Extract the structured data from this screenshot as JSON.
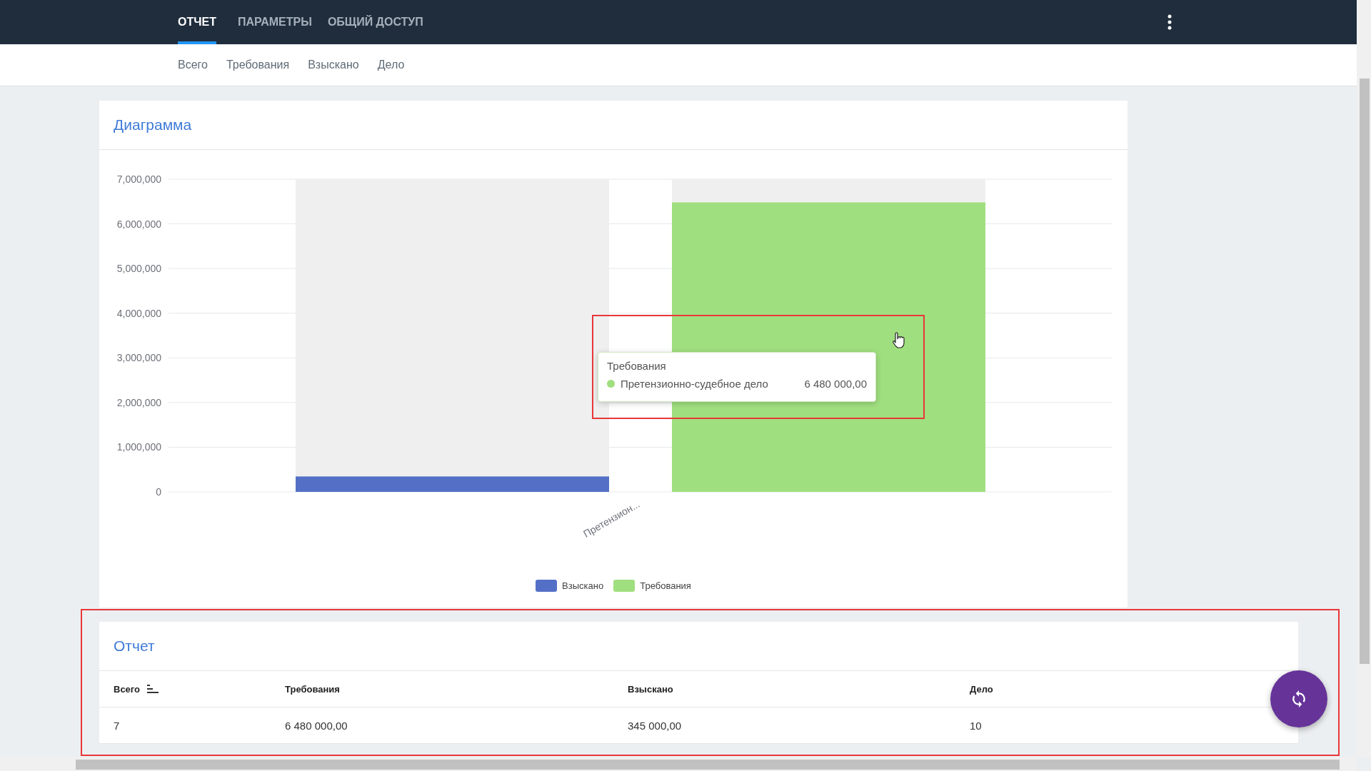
{
  "top_tabs": [
    {
      "label": "ОТЧЕТ",
      "selected": true
    },
    {
      "label": "ПАРАМЕТРЫ",
      "selected": false
    },
    {
      "label": "ОБЩИЙ ДОСТУП",
      "selected": false
    }
  ],
  "sub_nav": [
    "Всего",
    "Требования",
    "Взыскано",
    "Дело"
  ],
  "chart_card": {
    "title": "Диаграмма",
    "chart_data": {
      "type": "bar",
      "categories": [
        "Претензион..."
      ],
      "series": [
        {
          "name": "Взыскано",
          "color": "#5470c6",
          "values": [
            345000
          ]
        },
        {
          "name": "Требования",
          "color": "#a0df7f",
          "values": [
            6480000
          ]
        }
      ],
      "ylim": [
        0,
        7000000
      ],
      "grid": true,
      "yticks": [
        {
          "value": 0,
          "label": "0"
        },
        {
          "value": 1000000,
          "label": "1,000,000"
        },
        {
          "value": 2000000,
          "label": "2,000,000"
        },
        {
          "value": 3000000,
          "label": "3,000,000"
        },
        {
          "value": 4000000,
          "label": "4,000,000"
        },
        {
          "value": 5000000,
          "label": "5,000,000"
        },
        {
          "value": 6000000,
          "label": "6,000,000"
        },
        {
          "value": 7000000,
          "label": "7,000,000"
        }
      ]
    },
    "tooltip": {
      "title": "Требования",
      "rows": [
        {
          "label": "Претензионно-судебное дело",
          "value": "6 480 000,00",
          "color": "#a0df7f"
        }
      ]
    }
  },
  "report_card": {
    "title": "Отчет",
    "columns": [
      {
        "label": "Всего",
        "sorted": true
      },
      {
        "label": "Требования",
        "sorted": false
      },
      {
        "label": "Взыскано",
        "sorted": false
      },
      {
        "label": "Дело",
        "sorted": false
      }
    ],
    "rows": [
      [
        "7",
        "6 480 000,00",
        "345 000,00",
        "10"
      ]
    ]
  }
}
